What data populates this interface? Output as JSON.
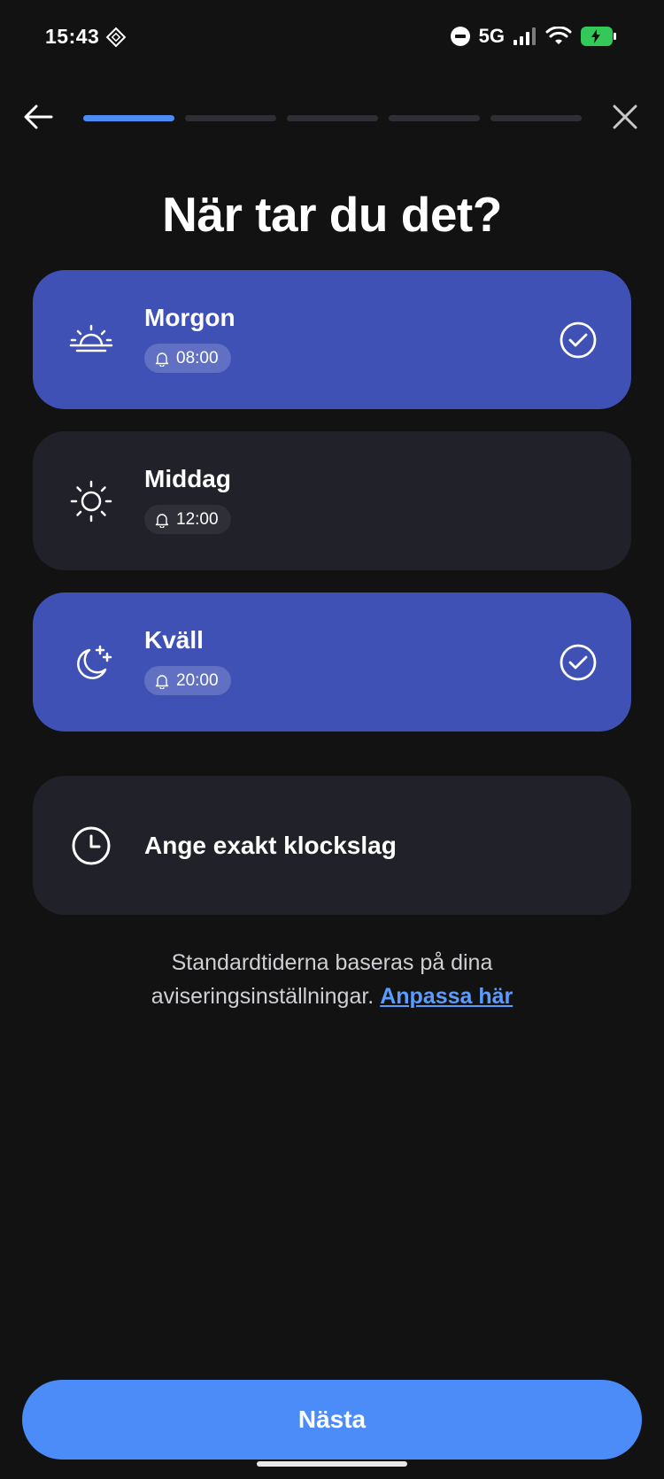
{
  "status_bar": {
    "time": "15:43",
    "network": "5G",
    "battery_color": "#34c759"
  },
  "nav": {
    "progress_total_steps": 5,
    "progress_current_step": 1
  },
  "title": "När tar du det?",
  "options": [
    {
      "label": "Morgon",
      "time": "08:00",
      "icon": "sunrise-icon",
      "selected": true
    },
    {
      "label": "Middag",
      "time": "12:00",
      "icon": "sun-icon",
      "selected": false
    },
    {
      "label": "Kväll",
      "time": "20:00",
      "icon": "moon-stars-icon",
      "selected": true
    },
    {
      "label": "Ange exakt klockslag",
      "icon": "clock-icon",
      "selected": false
    }
  ],
  "info": {
    "text": "Standardtiderna baseras på dina aviseringsinställningar.",
    "link": "Anpassa här"
  },
  "next_button": "Nästa",
  "colors": {
    "background": "#121212",
    "card": "#212129",
    "card_selected": "#3f51b5",
    "accent": "#4b8cf9",
    "link": "#5a9cff"
  }
}
